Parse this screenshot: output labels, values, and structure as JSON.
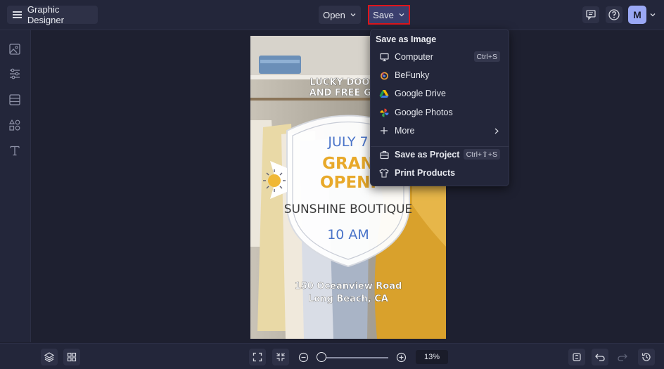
{
  "header": {
    "app_title": "Graphic Designer",
    "open_label": "Open",
    "save_label": "Save",
    "avatar_initial": "M"
  },
  "save_menu": {
    "heading": "Save as Image",
    "items": [
      {
        "label": "Computer",
        "shortcut": "Ctrl+S",
        "icon": "monitor-icon"
      },
      {
        "label": "BeFunky",
        "icon": "befunky-icon"
      },
      {
        "label": "Google Drive",
        "icon": "google-drive-icon"
      },
      {
        "label": "Google Photos",
        "icon": "google-photos-icon"
      },
      {
        "label": "More",
        "icon": "plus-icon"
      },
      {
        "label": "Save as Project",
        "shortcut": "Ctrl+⇧+S",
        "icon": "project-icon"
      },
      {
        "label": "Print Products",
        "icon": "tshirt-icon"
      }
    ]
  },
  "poster": {
    "top_line1": "LUCKY DOOR P",
    "top_line2": "AND FREE GIFT",
    "date": "JULY 7",
    "headline1": "GRAN",
    "headline2": "OPENI",
    "store": "SUNSHINE BOUTIQUE",
    "time": "10 AM",
    "address1": "150 Oceanview Road",
    "address2": "Long Beach, CA"
  },
  "zoom": {
    "level_label": "13%",
    "level": 0.13
  },
  "colors": {
    "accent_save": "#3b3f6e",
    "highlight_border": "#e0151b",
    "poster_gold": "#e8a92a",
    "poster_blue": "#4a74c9"
  }
}
